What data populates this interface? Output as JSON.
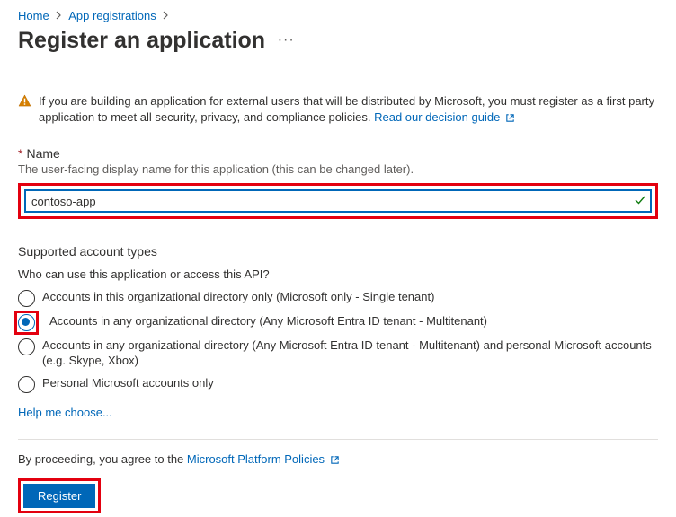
{
  "breadcrumb": {
    "home": "Home",
    "appreg": "App registrations"
  },
  "title": "Register an application",
  "info": {
    "text": "If you are building an application for external users that will be distributed by Microsoft, you must register as a first party application to meet all security, privacy, and compliance policies. ",
    "link": "Read our decision guide"
  },
  "name_field": {
    "label": "Name",
    "help": "The user-facing display name for this application (this can be changed later).",
    "value": "contoso-app"
  },
  "account_types": {
    "heading": "Supported account types",
    "question": "Who can use this application or access this API?",
    "options": [
      "Accounts in this organizational directory only (Microsoft only - Single tenant)",
      "Accounts in any organizational directory (Any Microsoft Entra ID tenant - Multitenant)",
      "Accounts in any organizational directory (Any Microsoft Entra ID tenant - Multitenant) and personal Microsoft accounts (e.g. Skype, Xbox)",
      "Personal Microsoft accounts only"
    ],
    "help_link": "Help me choose..."
  },
  "footer": {
    "policy_prefix": "By proceeding, you agree to the ",
    "policy_link": "Microsoft Platform Policies",
    "register": "Register"
  }
}
